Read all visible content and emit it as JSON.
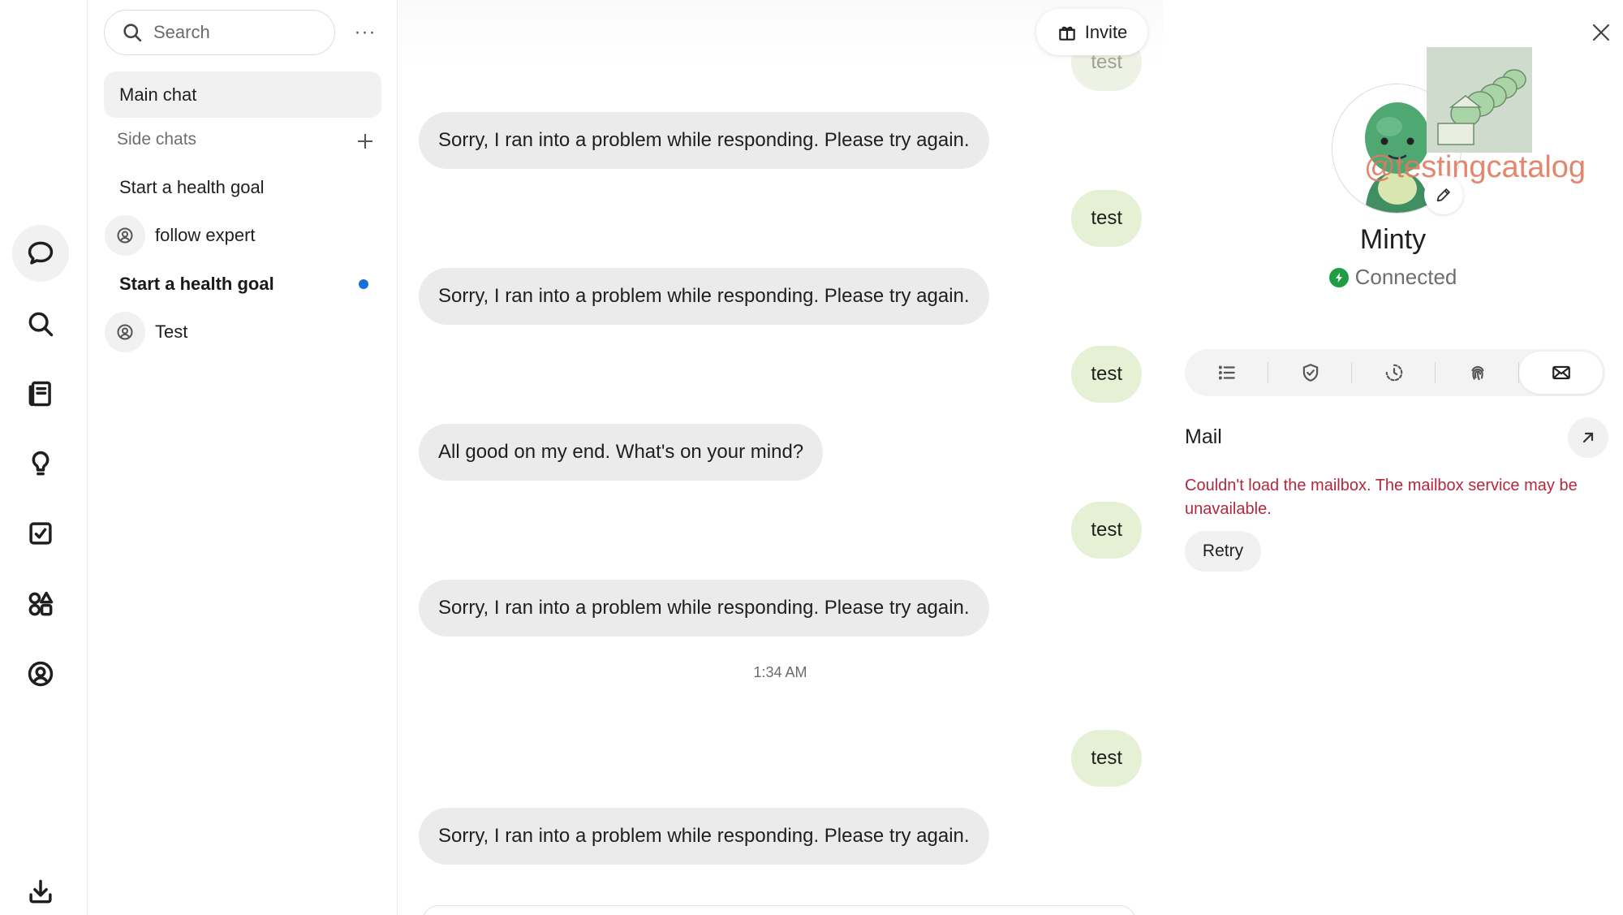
{
  "sidebar": {
    "search_placeholder": "Search",
    "more_label": "···",
    "main_chat": "Main chat",
    "side_chats_heading": "Side chats",
    "items": [
      {
        "label": "Start a health goal",
        "bold": false
      },
      {
        "label": "follow expert",
        "bold": false
      },
      {
        "label": "Start a health goal",
        "bold": true,
        "unread": true
      },
      {
        "label": "Test",
        "bold": false
      }
    ]
  },
  "chat": {
    "invite_label": "Invite",
    "messages": [
      {
        "from": "user",
        "text": "test"
      },
      {
        "from": "bot",
        "text": "Sorry, I ran into a problem while responding. Please try again."
      },
      {
        "from": "user",
        "text": "test"
      },
      {
        "from": "bot",
        "text": "Sorry, I ran into a problem while responding. Please try again."
      },
      {
        "from": "user",
        "text": "test"
      },
      {
        "from": "bot",
        "text": "All good on my end. What's on your mind?"
      },
      {
        "from": "user",
        "text": "test"
      },
      {
        "from": "bot",
        "text": "Sorry, I ran into a problem while responding. Please try again."
      },
      {
        "from": "user",
        "text": "test"
      },
      {
        "from": "bot",
        "text": "Sorry, I ran into a problem while responding. Please try again."
      }
    ],
    "timestamp": "1:34 AM"
  },
  "panel": {
    "watermark": "@testingcatalog",
    "name": "Minty",
    "status": "Connected",
    "tabs": [
      "list-icon",
      "shield-check-icon",
      "dashed-clock-icon",
      "fingerprint-icon",
      "mail-icon"
    ],
    "active_tab": "mail",
    "mail_title": "Mail",
    "mail_error": "Couldn't load the mailbox. The mailbox service may be unavailable.",
    "retry_label": "Retry"
  },
  "colors": {
    "user_bubble": "#e6f0d4",
    "bot_bubble": "#ebebeb",
    "error_text": "#b3283f",
    "connected_green": "#1f9d45",
    "unread_dot": "#1a6fd8"
  }
}
